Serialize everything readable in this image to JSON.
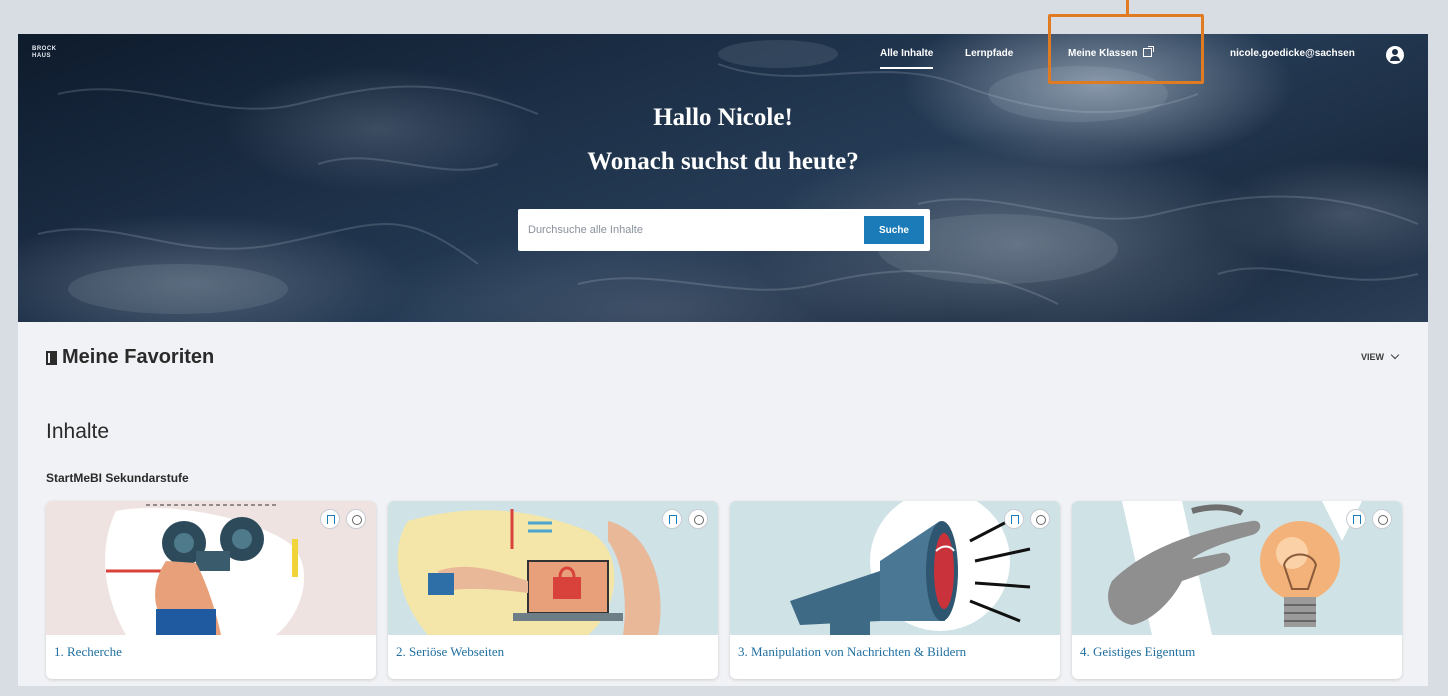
{
  "brand": {
    "line1": "BROCK",
    "line2": "HAUS"
  },
  "nav": {
    "items": [
      {
        "label": "Alle Inhalte"
      },
      {
        "label": "Lernpfade"
      },
      {
        "label": "Meine Klassen"
      }
    ],
    "user": "nicole.goedicke@sachsen"
  },
  "hero": {
    "greeting": "Hallo Nicole!",
    "subtitle": "Wonach suchst du heute?"
  },
  "search": {
    "placeholder": "Durchsuche alle Inhalte",
    "button": "Suche"
  },
  "favorites": {
    "title": "Meine Favoriten",
    "view_toggle": "VIEW"
  },
  "content": {
    "section_title": "Inhalte",
    "collection_title": "StartMeBI Sekundarstufe",
    "cards": [
      {
        "label": "1. Recherche"
      },
      {
        "label": "2. Seriöse Webseiten"
      },
      {
        "label": "3. Manipulation von Nachrichten & Bildern"
      },
      {
        "label": "4. Geistiges Eigentum"
      }
    ]
  },
  "icons": {
    "favorites": "bookmark-icon",
    "user": "user-icon",
    "external": "external-link-icon",
    "toggle": "chevron-down-icon",
    "card_bookmark": "bookmark-icon",
    "card_info": "info-icon"
  },
  "colors": {
    "accent": "#1b7ab8",
    "callout": "#e07b22",
    "card_title": "#1f6fa0"
  }
}
